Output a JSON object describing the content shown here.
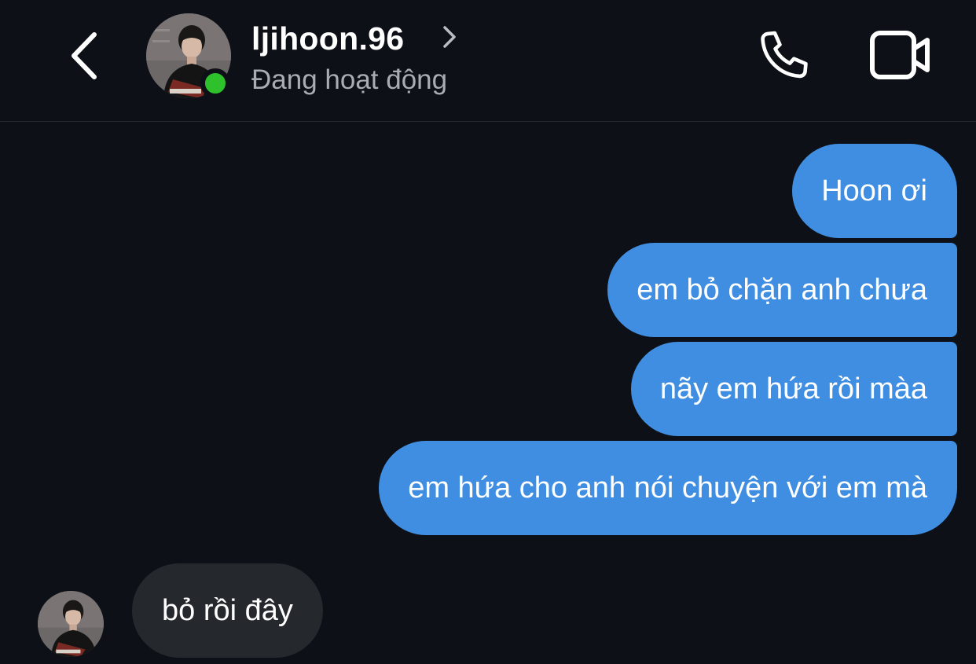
{
  "header": {
    "username": "ljihoon.96",
    "status": "Đang hoạt động",
    "back_icon": "chevron-left-icon",
    "call_icon": "phone-icon",
    "video_icon": "video-camera-icon",
    "online_color": "#2ec12b"
  },
  "messages": [
    {
      "from": "me",
      "text": "Hoon ơi"
    },
    {
      "from": "me",
      "text": "em bỏ chặn anh chưa"
    },
    {
      "from": "me",
      "text": "nãy em hứa rồi màa"
    },
    {
      "from": "me",
      "text": "em hứa cho anh nói chuyện với em mà"
    },
    {
      "from": "them",
      "text": "bỏ rồi đây"
    }
  ],
  "colors": {
    "background": "#0d1016",
    "outgoing_bubble": "#408ee2",
    "incoming_bubble": "#25282d",
    "status_text": "#a8acb3"
  }
}
